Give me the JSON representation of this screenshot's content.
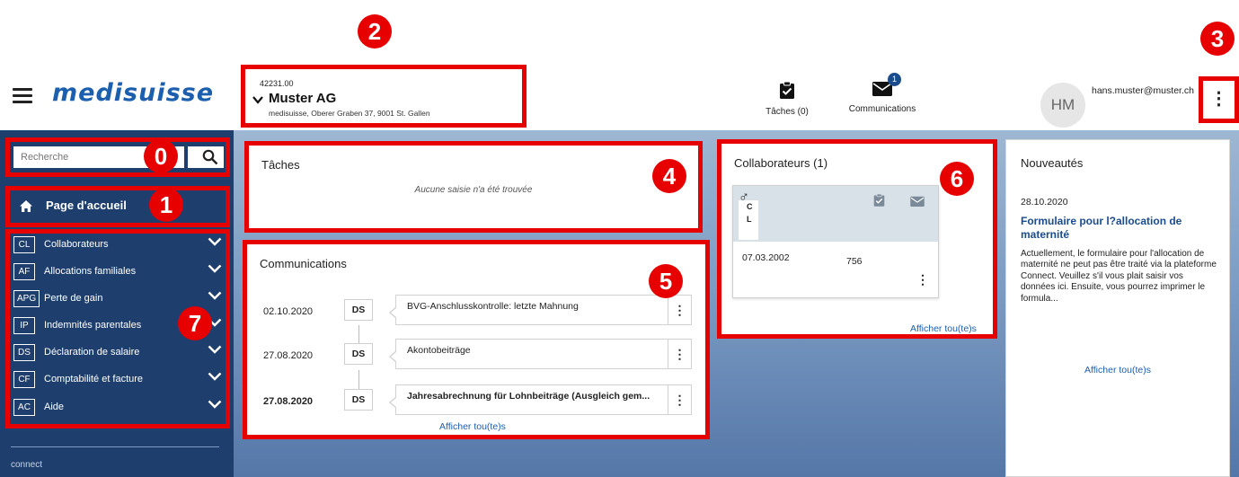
{
  "header": {
    "logo_text": "medisuisse",
    "company": {
      "number": "42231.00",
      "name": "Muster AG",
      "address": "medisuisse, Oberer Graben 37, 9001 St. Gallen"
    },
    "tasks_label": "Tâches (0)",
    "communications_label": "Communications",
    "communications_badge": "1",
    "user_initials": "HM",
    "user_email": "hans.muster@muster.ch"
  },
  "annotations": {
    "n0": "0",
    "n1": "1",
    "n2": "2",
    "n3": "3",
    "n4": "4",
    "n5": "5",
    "n6": "6",
    "n7": "7",
    "color": "#e60000"
  },
  "sidebar": {
    "search_placeholder": "Recherche",
    "home_label": "Page d'accueil",
    "items": [
      {
        "code": "CL",
        "label": "Collaborateurs"
      },
      {
        "code": "AF",
        "label": "Allocations familiales"
      },
      {
        "code": "APG",
        "label": "Perte de gain"
      },
      {
        "code": "IP",
        "label": "Indemnités parentales"
      },
      {
        "code": "DS",
        "label": "Déclaration de salaire"
      },
      {
        "code": "CF",
        "label": "Comptabilité et facture"
      },
      {
        "code": "AC",
        "label": "Aide"
      }
    ],
    "footer": "connect"
  },
  "tasks_panel": {
    "title": "Tâches",
    "empty_message": "Aucune saisie n'a été trouvée"
  },
  "communications_panel": {
    "title": "Communications",
    "rows": [
      {
        "date": "02.10.2020",
        "tag": "DS",
        "text": "BVG-Anschlusskontrolle: letzte Mahnung",
        "unread": false
      },
      {
        "date": "27.08.2020",
        "tag": "DS",
        "text": "Akontobeiträge",
        "unread": false
      },
      {
        "date": "27.08.2020",
        "tag": "DS",
        "text": "Jahresabrechnung für Lohnbeiträge (Ausgleich gem...",
        "unread": true
      }
    ],
    "show_all": "Afficher tou(te)s"
  },
  "employees_panel": {
    "title": "Collaborateurs (1)",
    "card": {
      "gender_symbol": "♂",
      "initial_first": "C",
      "initial_last": "L",
      "birth_date": "07.03.2002",
      "avs_prefix": "756"
    },
    "show_all": "Afficher tou(te)s"
  },
  "news_panel": {
    "title": "Nouveautés",
    "date": "28.10.2020",
    "headline": "Formulaire pour l?allocation de maternité",
    "body": "Actuellement, le formulaire pour l'allocation de maternité ne peut pas être traité via la plateforme Connect. Veuillez s'il vous plait saisir vos données ici. Ensuite, vous pourrez imprimer le formula...",
    "show_all": "Afficher tou(te)s"
  },
  "colors": {
    "brand_blue": "#1b5fae",
    "sidebar_bg": "#1e3f6e",
    "highlight_red": "#e60000"
  }
}
